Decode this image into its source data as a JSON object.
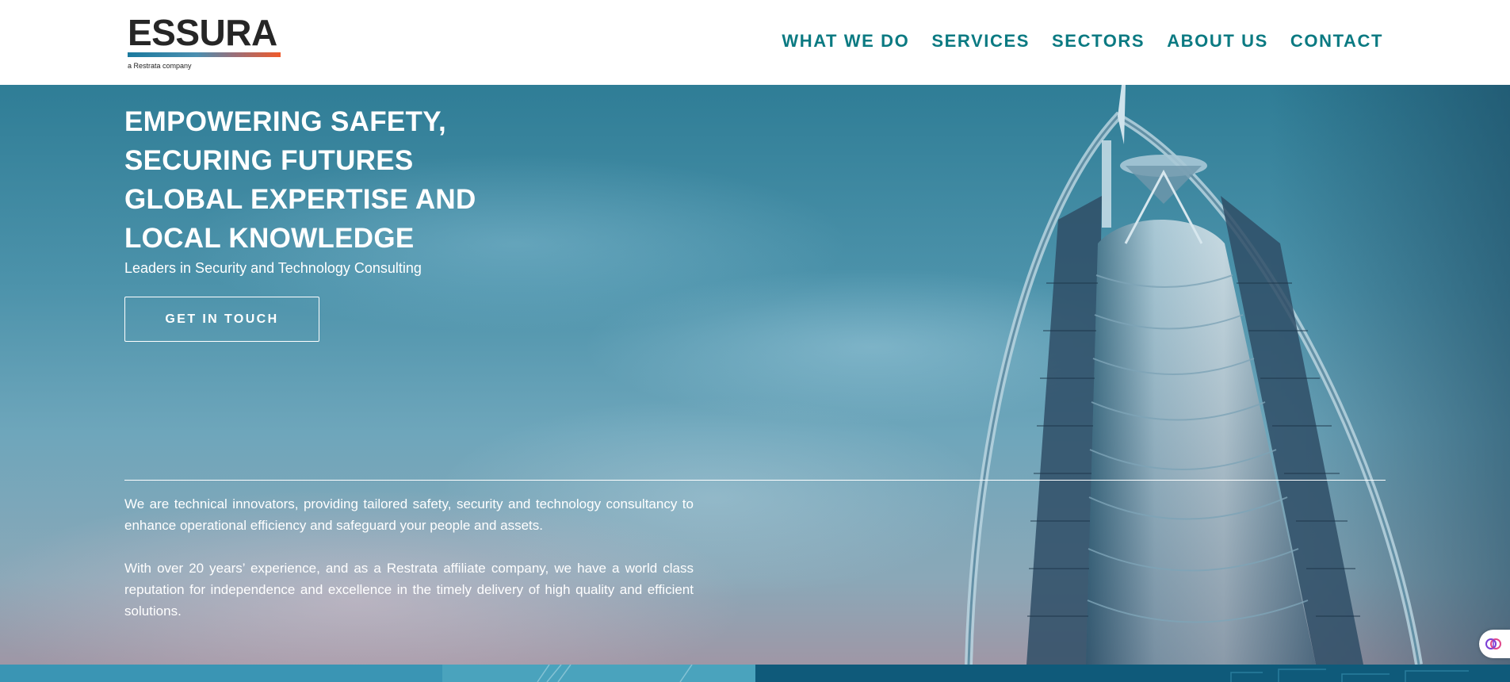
{
  "header": {
    "logo_text": "ESSURA",
    "logo_subtitle": "a Restrata company",
    "nav": [
      {
        "label": "WHAT WE DO"
      },
      {
        "label": "SERVICES"
      },
      {
        "label": "SECTORS"
      },
      {
        "label": "ABOUT US"
      },
      {
        "label": "CONTACT"
      }
    ],
    "nav_color": "#0b7a82"
  },
  "hero": {
    "headline_lines": [
      "EMPOWERING SAFETY,",
      "SECURING FUTURES",
      "GLOBAL EXPERTISE AND",
      "LOCAL KNOWLEDGE"
    ],
    "tagline": "Leaders in Security and Technology Consulting",
    "cta_label": "GET IN TOUCH",
    "paragraphs": [
      "We are technical innovators, providing tailored safety, security and technology consultancy to enhance operational efficiency and safeguard your people and assets.",
      "With over 20 years’ experience, and as a Restrata affiliate company, we have a world class reputation for independence and excellence in the timely delivery of high quality and efficient solutions."
    ]
  },
  "widget": {
    "icon": "brain-icon"
  },
  "colors": {
    "logo_gradient_start": "#1b7a9e",
    "logo_gradient_end": "#f05a2a",
    "hero_top": "#2f7d96"
  }
}
